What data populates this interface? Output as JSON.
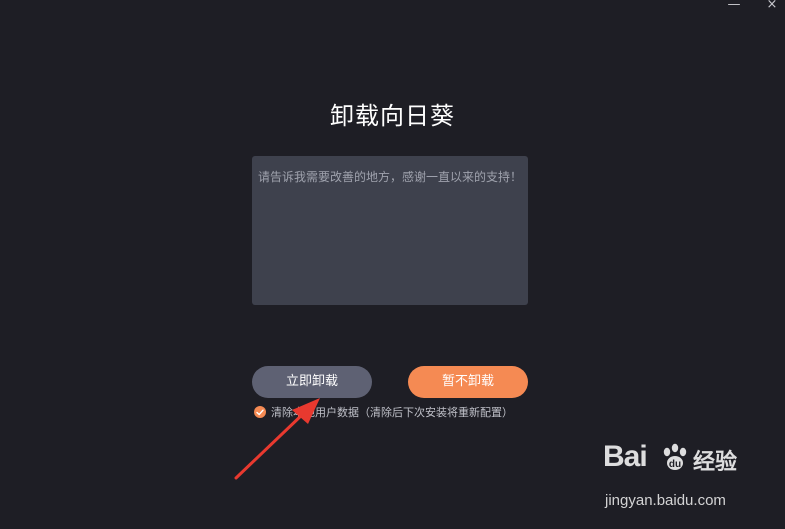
{
  "window": {
    "minimize_label": "—",
    "close_label": "×"
  },
  "dialog": {
    "title": "卸载向日葵",
    "feedback_placeholder": "请告诉我需要改善的地方，感谢一直以来的支持！",
    "feedback_value": "",
    "uninstall_label": "立即卸载",
    "keep_label": "暂不卸载",
    "clear_data_checked": true,
    "clear_data_label": "清除本地用户数据（清除后下次安装将重新配置）"
  },
  "annotation": {
    "arrow_color": "#e8392f"
  },
  "watermark": {
    "logo_text": "Bai",
    "logo_suffix": "经验",
    "url": "jingyan.baidu.com"
  },
  "colors": {
    "background": "#1e1e25",
    "textarea": "#3e414d",
    "uninstall_button": "#5e6173",
    "keep_button": "#f58a53",
    "checkbox": "#f58a53"
  }
}
